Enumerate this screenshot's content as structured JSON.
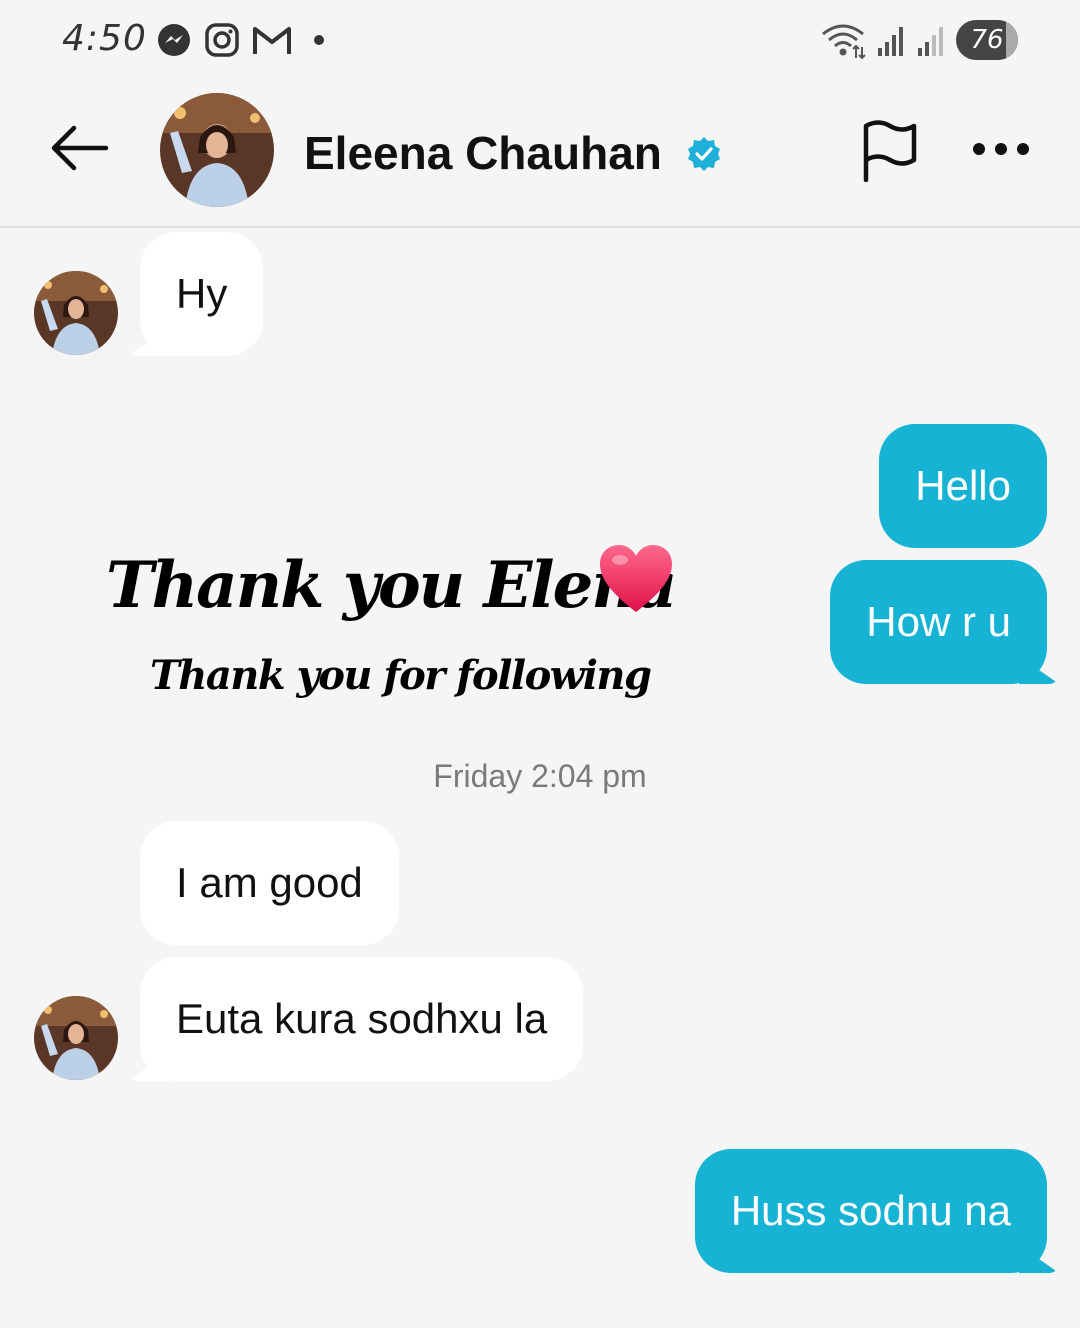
{
  "status_bar": {
    "time": "4:50",
    "battery": "76",
    "icons": [
      "messenger-icon",
      "instagram-icon",
      "gmail-icon",
      "notification-dot-icon",
      "wifi-icon",
      "signal-icon",
      "signal-icon"
    ]
  },
  "header": {
    "name": "Eleena Chauhan",
    "verified": true,
    "verified_color": "#1fb0d9",
    "icons": [
      "back-arrow-icon",
      "flag-icon",
      "more-icon"
    ]
  },
  "messages": [
    {
      "direction": "incoming",
      "text": "Hy"
    },
    {
      "direction": "outgoing",
      "text": "Hello"
    },
    {
      "direction": "outgoing",
      "text": "How r u"
    },
    {
      "direction": "incoming",
      "text": "I am good"
    },
    {
      "direction": "incoming",
      "text": "Euta kura sodhxu la"
    },
    {
      "direction": "outgoing",
      "text": "Huss sodnu na"
    }
  ],
  "timestamp": "Friday 2:04 pm",
  "overlay": {
    "title": "Thank you Elena",
    "subtitle": "Thank you for following"
  },
  "colors": {
    "outgoing_bubble": "#16b3d4",
    "incoming_bubble": "#ffffff",
    "background": "#f5f5f5",
    "heart": "#f0306a"
  }
}
